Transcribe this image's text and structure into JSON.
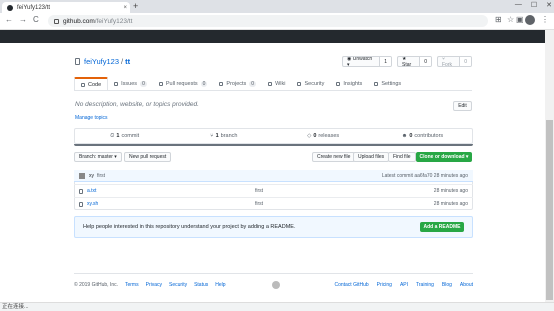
{
  "browser": {
    "tab_title": "feiYufy123/tt",
    "new_tab": "+",
    "tab_close": "×",
    "window_controls": [
      "—",
      "☐",
      "✕"
    ],
    "nav": {
      "back": "←",
      "forward": "→",
      "reload": "C"
    },
    "address": {
      "host": "github.com",
      "path": "/feiYufy123/tt"
    },
    "toolbar_icons": [
      "translate-icon",
      "star-icon",
      "extensions-icon",
      "profile-icon",
      "menu-icon"
    ],
    "toolbar_glyphs": [
      "⊞",
      "☆",
      "▣",
      "⋮"
    ],
    "status_text": "正在连接..."
  },
  "repo": {
    "owner": "feiYufy123",
    "separator": "/",
    "name": "tt",
    "actions": [
      {
        "label": "◉ Unwatch ▾",
        "count": "1"
      },
      {
        "label": "★ Star",
        "count": "0"
      },
      {
        "label": "⑂ Fork",
        "count": "0"
      }
    ],
    "tabs": [
      {
        "label": "Code",
        "count": null,
        "selected": true
      },
      {
        "label": "Issues",
        "count": "0"
      },
      {
        "label": "Pull requests",
        "count": "0"
      },
      {
        "label": "Projects",
        "count": "0"
      },
      {
        "label": "Wiki",
        "count": null
      },
      {
        "label": "Security",
        "count": null
      },
      {
        "label": "Insights",
        "count": null
      },
      {
        "label": "Settings",
        "count": null
      }
    ],
    "description": "No description, website, or topics provided.",
    "manage_topics": "Manage topics",
    "edit": "Edit",
    "stats": [
      {
        "num": "1",
        "label": "commit"
      },
      {
        "num": "1",
        "label": "branch"
      },
      {
        "num": "0",
        "label": "releases"
      },
      {
        "num": "0",
        "label": "contributors"
      }
    ],
    "branch_button": "Branch: master ▾",
    "new_pr": "New pull request",
    "create_file": "Create new file",
    "upload": "Upload files",
    "find": "Find file",
    "clone": "Clone or download ▾",
    "commit": {
      "author": "xy",
      "message": "first",
      "latest": "Latest commit aa6fa70 28 minutes ago"
    },
    "files": [
      {
        "name": "a.txt",
        "message": "first",
        "age": "28 minutes ago"
      },
      {
        "name": "xy.sh",
        "message": "first",
        "age": "28 minutes ago"
      }
    ],
    "readme_text": "Help people interested in this repository understand your project by adding a README.",
    "readme_button": "Add a README"
  },
  "footer": {
    "copyright": "© 2019 GitHub, Inc.",
    "left_links": [
      "Terms",
      "Privacy",
      "Security",
      "Status",
      "Help"
    ],
    "right_links": [
      "Contact GitHub",
      "Pricing",
      "API",
      "Training",
      "Blog",
      "About"
    ]
  }
}
